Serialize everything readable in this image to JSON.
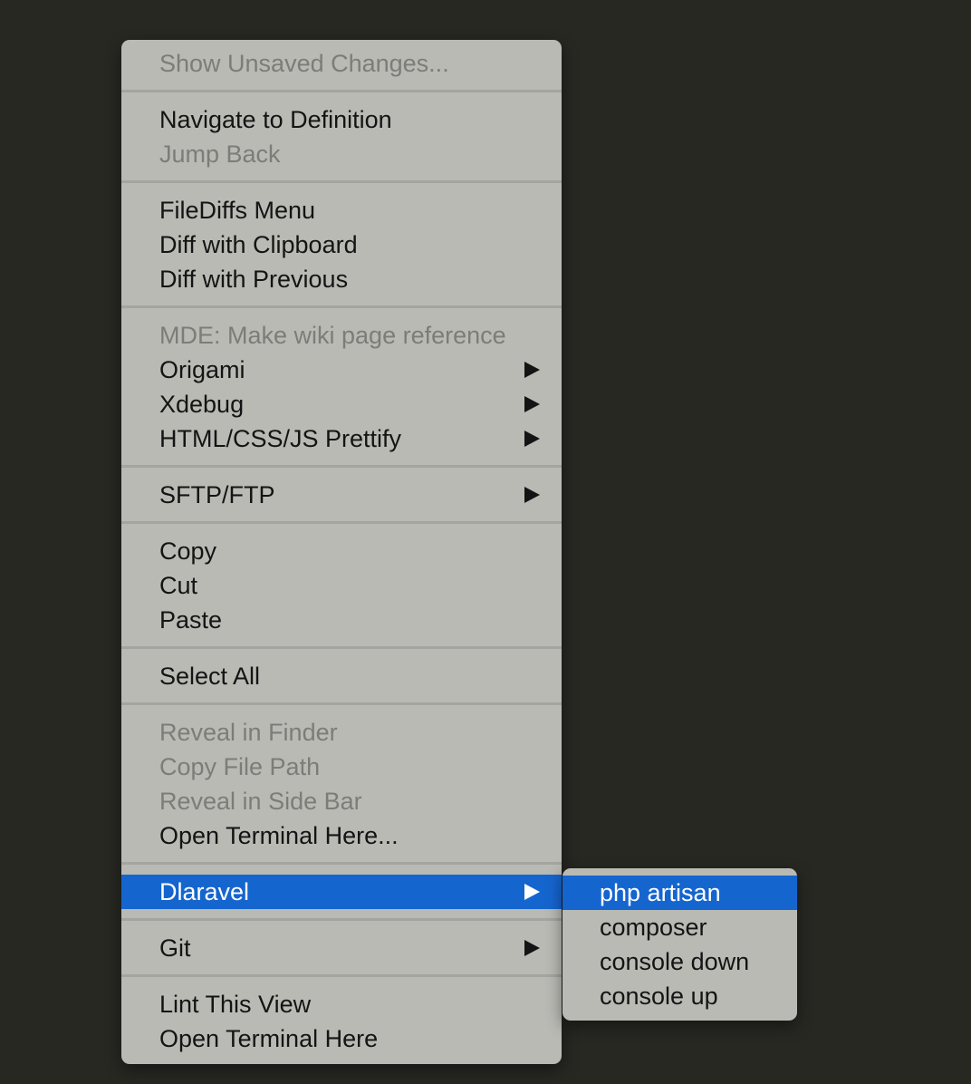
{
  "main_menu": {
    "groups": [
      [
        {
          "label": "Show Unsaved Changes...",
          "enabled": false,
          "submenu": false
        }
      ],
      [
        {
          "label": "Navigate to Definition",
          "enabled": true,
          "submenu": false
        },
        {
          "label": "Jump Back",
          "enabled": false,
          "submenu": false
        }
      ],
      [
        {
          "label": "FileDiffs Menu",
          "enabled": true,
          "submenu": false
        },
        {
          "label": "Diff with Clipboard",
          "enabled": true,
          "submenu": false
        },
        {
          "label": "Diff with Previous",
          "enabled": true,
          "submenu": false
        }
      ],
      [
        {
          "label": "MDE: Make wiki page reference",
          "enabled": false,
          "submenu": false
        },
        {
          "label": "Origami",
          "enabled": true,
          "submenu": true
        },
        {
          "label": "Xdebug",
          "enabled": true,
          "submenu": true
        },
        {
          "label": "HTML/CSS/JS Prettify",
          "enabled": true,
          "submenu": true
        }
      ],
      [
        {
          "label": "SFTP/FTP",
          "enabled": true,
          "submenu": true
        }
      ],
      [
        {
          "label": "Copy",
          "enabled": true,
          "submenu": false
        },
        {
          "label": "Cut",
          "enabled": true,
          "submenu": false
        },
        {
          "label": "Paste",
          "enabled": true,
          "submenu": false
        }
      ],
      [
        {
          "label": "Select All",
          "enabled": true,
          "submenu": false
        }
      ],
      [
        {
          "label": "Reveal in Finder",
          "enabled": false,
          "submenu": false
        },
        {
          "label": "Copy File Path",
          "enabled": false,
          "submenu": false
        },
        {
          "label": "Reveal in Side Bar",
          "enabled": false,
          "submenu": false
        },
        {
          "label": "Open Terminal Here...",
          "enabled": true,
          "submenu": false
        }
      ],
      [
        {
          "label": "Dlaravel",
          "enabled": true,
          "submenu": true,
          "highlighted": true
        }
      ],
      [
        {
          "label": "Git",
          "enabled": true,
          "submenu": true
        }
      ],
      [
        {
          "label": "Lint This View",
          "enabled": true,
          "submenu": false
        },
        {
          "label": "Open Terminal Here",
          "enabled": true,
          "submenu": false
        }
      ]
    ]
  },
  "sub_menu": {
    "items": [
      {
        "label": "php artisan",
        "highlighted": true
      },
      {
        "label": "composer"
      },
      {
        "label": "console down"
      },
      {
        "label": "console up"
      }
    ]
  },
  "colors": {
    "background": "#272822",
    "menu_bg": "#b9bab4",
    "highlight": "#1565cf",
    "text": "#141414",
    "disabled_text": "#7c7d78"
  }
}
